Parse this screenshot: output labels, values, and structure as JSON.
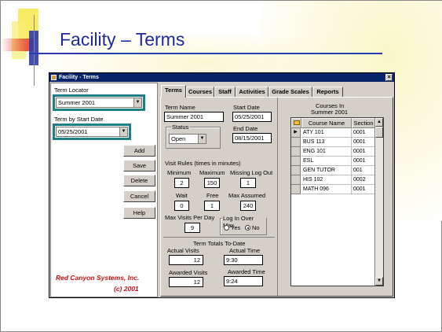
{
  "slide": {
    "title": "Facility – Terms"
  },
  "window": {
    "title": "Facility - Terms",
    "close_label": "×"
  },
  "left_panel": {
    "term_locator_label": "Term Locator",
    "term_locator_value": "Summer 2001",
    "term_by_start_label": "Term by Start Date",
    "term_by_start_value": "05/25/2001",
    "buttons": {
      "add": "Add",
      "save": "Save",
      "delete": "Delete",
      "cancel": "Cancel",
      "help": "Help"
    },
    "brand": "Red Canyon Systems, Inc.",
    "copyright": "(c) 2001"
  },
  "tabs": [
    "Terms",
    "Courses",
    "Staff",
    "Activities",
    "Grade Scales",
    "Reports"
  ],
  "terms_tab": {
    "term_name_label": "Term Name",
    "term_name_value": "Summer 2001",
    "start_date_label": "Start Date",
    "start_date_value": "05/25/2001",
    "status_label": "Status",
    "status_value": "Open",
    "end_date_label": "End Date",
    "end_date_value": "08/15/2001",
    "visit_rules_label": "Visit Rules   (times in minutes)",
    "minimum_label": "Minimum",
    "minimum_value": "2",
    "maximum_label": "Maximum",
    "maximum_value": "150",
    "missing_logout_label": "Missing Log Out",
    "missing_logout_value": "1",
    "wait_label": "Wait",
    "wait_value": "0",
    "free_label": "Free",
    "free_value": "1",
    "max_assumed_label": "Max Assumed",
    "max_assumed_value": "240",
    "max_visits_label": "Max Visits Per Day",
    "max_visits_value": "9",
    "login_over_max_label": "Log In Over Max",
    "yes_label": "Yes",
    "no_label": "No",
    "totals_label": "Term Totals To-Date",
    "actual_visits_label": "Actual Visits",
    "actual_visits_value": "12",
    "actual_time_label": "Actual Time",
    "actual_time_value": "9:30",
    "awarded_visits_label": "Awarded Visits",
    "awarded_visits_value": "12",
    "awarded_time_label": "Awarded Time",
    "awarded_time_value": "9:24"
  },
  "courses_grid": {
    "heading_line1": "Courses In",
    "heading_line2": "Summer 2001",
    "columns": [
      "Course Name",
      "Section"
    ],
    "rows": [
      [
        "ATY 101",
        "0001"
      ],
      [
        "BUS 113",
        "0001"
      ],
      [
        "ENG 101",
        "0001"
      ],
      [
        "ESL",
        "0001"
      ],
      [
        "GEN TUTOR",
        "001"
      ],
      [
        "HIS 102",
        "0002"
      ],
      [
        "MATH 096",
        "0001"
      ]
    ]
  }
}
